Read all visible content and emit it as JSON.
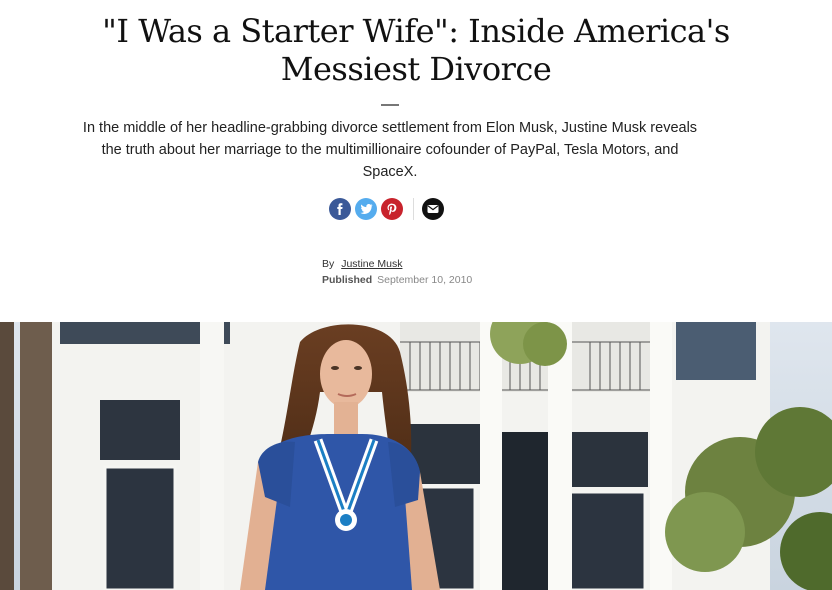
{
  "article": {
    "title": "\"I Was a Starter Wife\": Inside America's Messiest Divorce",
    "dek": "In the middle of her headline-grabbing divorce settlement from Elon Musk, Justine Musk reveals the truth about her marriage to the multimillionaire cofounder of PayPal, Tesla Motors, and SpaceX.",
    "byline": {
      "by_label": "By",
      "author": "Justine Musk",
      "published_label": "Published",
      "date": "September 10, 2010"
    }
  },
  "share": {
    "icons": [
      "facebook-icon",
      "twitter-icon",
      "pinterest-icon",
      "email-icon"
    ],
    "colors": {
      "facebook": "#3b5998",
      "twitter": "#55acee",
      "pinterest": "#c8232c",
      "email": "#111111"
    }
  },
  "hero_image": {
    "subject": "woman-in-blue-dress-photo"
  }
}
